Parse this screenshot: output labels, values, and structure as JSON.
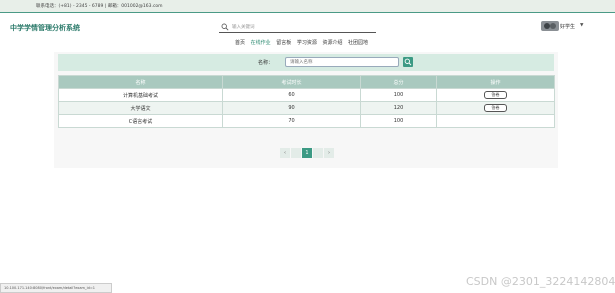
{
  "topbar": {
    "contact": "联系电话：(+81) - 2345 - 6789 | 邮箱：001002@163.com"
  },
  "header": {
    "site_title": "中学学情管理分析系统",
    "search_placeholder": "输入关键词",
    "username": "好学生",
    "caret": "▼"
  },
  "nav": {
    "items": [
      "首页",
      "在线作业",
      "留言板",
      "学习资源",
      "资源介绍",
      "社团园地"
    ],
    "active_index": 1
  },
  "filter": {
    "label": "名称：",
    "placeholder": "请输入名称",
    "button_icon": "search-icon"
  },
  "table": {
    "columns": [
      "名称",
      "考试时长",
      "总分",
      "操作"
    ],
    "rows": [
      {
        "name": "计算机基础考试",
        "duration": "60",
        "total": "100",
        "action": "答卷"
      },
      {
        "name": "大学语文",
        "duration": "90",
        "total": "120",
        "action": "答卷"
      },
      {
        "name": "C语言考试",
        "duration": "70",
        "total": "100",
        "action": ""
      }
    ]
  },
  "pager": {
    "prev": "‹",
    "current": "1",
    "next": "›"
  },
  "statusbar": {
    "url": "10.100.171.140:8080/front/exam/detail?exam_id=1"
  },
  "watermark": "CSDN @2301_3224142804",
  "colors": {
    "accent": "#3c9a84",
    "header_row": "#a9c9bf",
    "filter_bg": "#d6ebe2"
  }
}
